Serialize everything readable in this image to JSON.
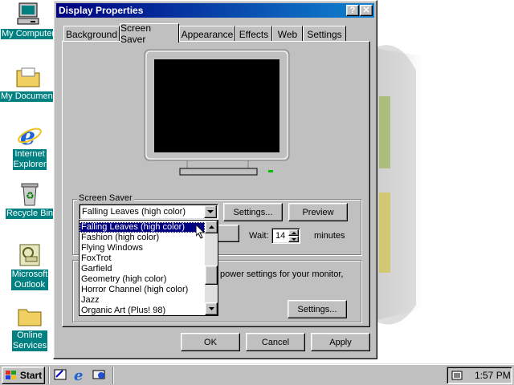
{
  "desktop": {
    "icons": [
      {
        "label": "My Computer",
        "icon": "computer-icon"
      },
      {
        "label": "My Documents",
        "icon": "folder-icon"
      },
      {
        "label": "Internet\nExplorer",
        "icon": "ie-icon"
      },
      {
        "label": "Recycle Bin",
        "icon": "recycle-bin-icon"
      },
      {
        "label": "Microsoft\nOutlook",
        "icon": "outlook-icon"
      },
      {
        "label": "Online\nServices",
        "icon": "folder-icon"
      }
    ]
  },
  "dialog": {
    "title": "Display Properties",
    "help_btn": "?",
    "close_btn": "✕",
    "tabs": [
      {
        "label": "Background",
        "active": false
      },
      {
        "label": "Screen Saver",
        "active": true
      },
      {
        "label": "Appearance",
        "active": false
      },
      {
        "label": "Effects",
        "active": false
      },
      {
        "label": "Web",
        "active": false
      },
      {
        "label": "Settings",
        "active": false
      }
    ],
    "screensaver_group_label": "Screen Saver",
    "screensaver_selected": "Falling Leaves (high color)",
    "settings_button": "Settings...",
    "preview_button": "Preview",
    "wait_label": "Wait:",
    "wait_value": "14",
    "minutes_label": "minutes",
    "dropdown_options": [
      "Falling Leaves (high color)",
      "Fashion (high color)",
      "Flying Windows",
      "FoxTrot",
      "Garfield",
      "Geometry (high color)",
      "Horror Channel (high color)",
      "Jazz",
      "Organic Art (Plus! 98)"
    ],
    "power_text": "power settings for your monitor,",
    "power_settings_button": "Settings...",
    "ok_button": "OK",
    "cancel_button": "Cancel",
    "apply_button": "Apply"
  },
  "taskbar": {
    "start_label": "Start",
    "clock": "1:57 PM"
  },
  "colors": {
    "desktop_label_bg": "#008080",
    "title_active": "#000080",
    "face": "#c0c0c0"
  }
}
